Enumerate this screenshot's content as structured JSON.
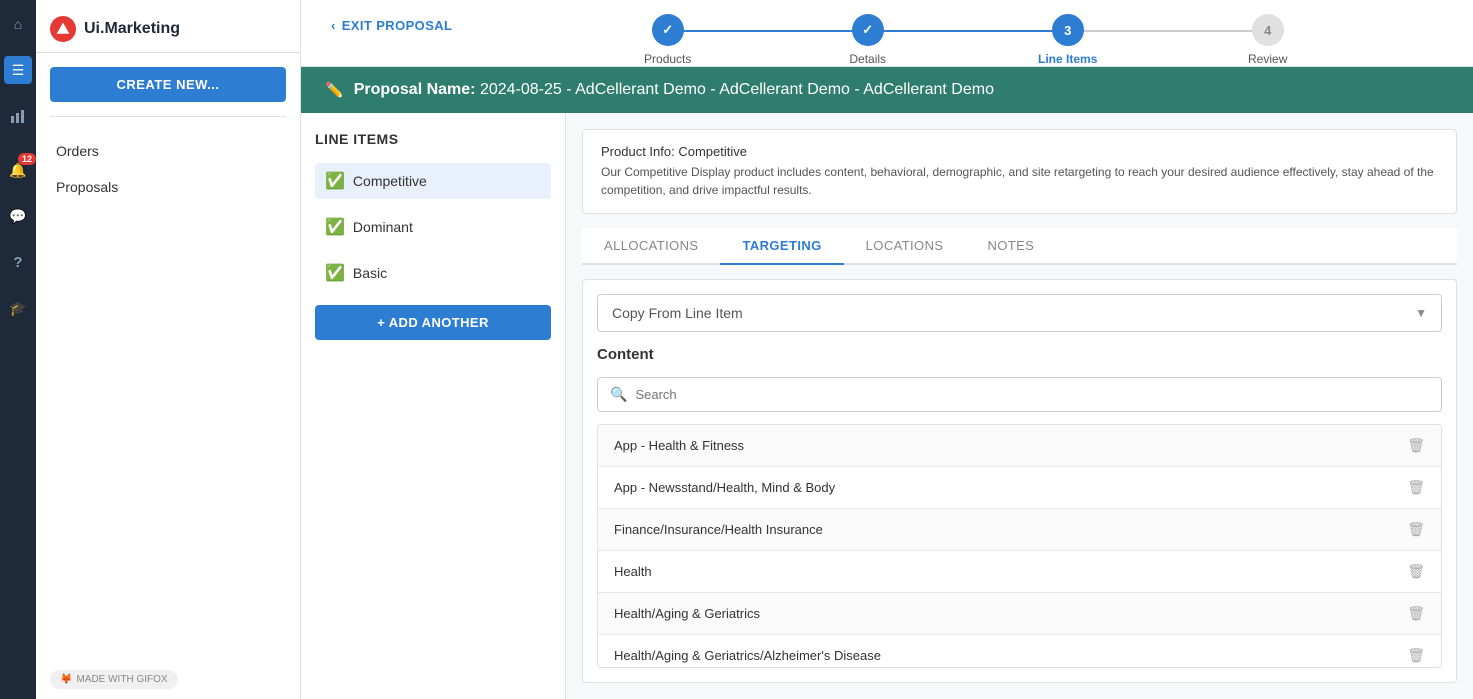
{
  "brand": {
    "name": "Ui.Marketing",
    "logo_char": "U"
  },
  "nav_rail": {
    "icons": [
      {
        "name": "home-icon",
        "glyph": "⌂",
        "active": false
      },
      {
        "name": "orders-icon",
        "glyph": "≡",
        "active": true,
        "label": "Orders"
      },
      {
        "name": "reports-icon",
        "glyph": "📊",
        "active": false,
        "label": "Reports"
      },
      {
        "name": "notification-icon",
        "glyph": "🔔",
        "active": false,
        "badge": "12"
      },
      {
        "name": "chat-icon",
        "glyph": "💬",
        "active": false
      },
      {
        "name": "help-icon",
        "glyph": "?",
        "active": false
      },
      {
        "name": "graduation-icon",
        "glyph": "🎓",
        "active": false
      }
    ]
  },
  "sidebar": {
    "create_btn": "CREATE NEW...",
    "nav_items": [
      {
        "label": "Orders"
      },
      {
        "label": "Proposals"
      }
    ]
  },
  "wizard": {
    "exit_label": "EXIT PROPOSAL",
    "steps": [
      {
        "label": "Products",
        "state": "done",
        "number": "✓"
      },
      {
        "label": "Details",
        "state": "done",
        "number": "✓"
      },
      {
        "label": "Line Items",
        "state": "active",
        "number": "3"
      },
      {
        "label": "Review",
        "state": "inactive",
        "number": "4"
      }
    ]
  },
  "proposal": {
    "label": "Proposal Name:",
    "name": "2024-08-25 - AdCellerant Demo - AdCellerant Demo - AdCellerant Demo"
  },
  "line_items": {
    "title": "LINE ITEMS",
    "items": [
      {
        "label": "Competitive",
        "active": true
      },
      {
        "label": "Dominant",
        "active": false
      },
      {
        "label": "Basic",
        "active": false
      }
    ],
    "add_btn": "+ ADD ANOTHER"
  },
  "product_info": {
    "label": "Product Info:",
    "product": "Competitive",
    "description": "Our Competitive Display product includes content, behavioral, demographic, and site retargeting to reach your desired audience effectively, stay ahead of the competition, and drive impactful results."
  },
  "tabs": [
    {
      "label": "ALLOCATIONS",
      "active": false
    },
    {
      "label": "TARGETING",
      "active": true
    },
    {
      "label": "LOCATIONS",
      "active": false
    },
    {
      "label": "NOTES",
      "active": false
    }
  ],
  "targeting": {
    "copy_dropdown_placeholder": "Copy From Line Item",
    "content_label": "Content",
    "search_placeholder": "Search",
    "content_items": [
      {
        "label": "App - Health & Fitness"
      },
      {
        "label": "App - Newsstand/Health, Mind & Body"
      },
      {
        "label": "Finance/Insurance/Health Insurance"
      },
      {
        "label": "Health"
      },
      {
        "label": "Health/Aging & Geriatrics"
      },
      {
        "label": "Health/Aging & Geriatrics/Alzheimer's Disease"
      }
    ]
  },
  "footer": {
    "badge": "MADE WITH GIFOX"
  }
}
